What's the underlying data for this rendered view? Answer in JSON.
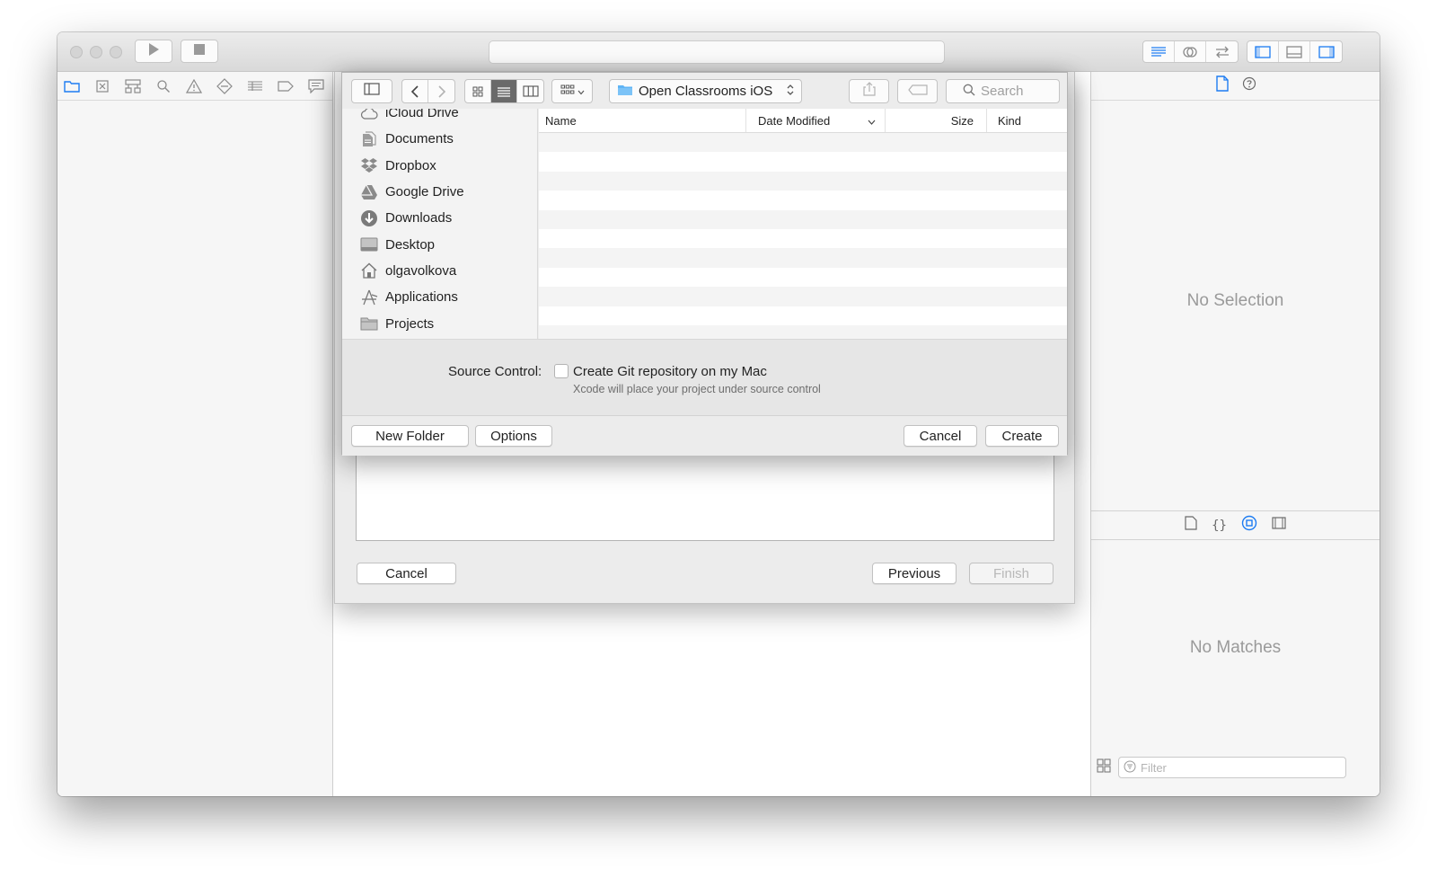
{
  "toolbar": {
    "activity_text": "",
    "run_icon": "play-icon",
    "stop_icon": "stop-icon"
  },
  "navigator": {
    "tabs": [
      "project-navigator-icon",
      "source-control-icon",
      "symbol-navigator-icon",
      "find-icon",
      "issue-icon",
      "test-icon",
      "debug-icon",
      "breakpoint-icon",
      "report-icon"
    ]
  },
  "inspector": {
    "no_selection": "No Selection",
    "no_matches": "No Matches",
    "filter_placeholder": "Filter"
  },
  "wizard": {
    "cancel_label": "Cancel",
    "previous_label": "Previous",
    "finish_label": "Finish"
  },
  "save_panel": {
    "location": "Open Classrooms iOS",
    "search_placeholder": "Search",
    "sidebar_items": [
      {
        "label": "iCloud Drive",
        "icon": "cloud-icon"
      },
      {
        "label": "Documents",
        "icon": "documents-icon"
      },
      {
        "label": "Dropbox",
        "icon": "dropbox-icon"
      },
      {
        "label": "Google Drive",
        "icon": "google-drive-icon"
      },
      {
        "label": "Downloads",
        "icon": "downloads-icon"
      },
      {
        "label": "Desktop",
        "icon": "desktop-icon"
      },
      {
        "label": "olgavolkova",
        "icon": "home-icon"
      },
      {
        "label": "Applications",
        "icon": "applications-icon"
      },
      {
        "label": "Projects",
        "icon": "folder-icon"
      }
    ],
    "columns": {
      "name": "Name",
      "date_modified": "Date Modified",
      "size": "Size",
      "kind": "Kind"
    },
    "source_control_label": "Source Control:",
    "git_checkbox_label": "Create Git repository on my Mac",
    "git_checked": false,
    "git_hint": "Xcode will place your project under source control",
    "new_folder_label": "New Folder",
    "options_label": "Options",
    "cancel_label": "Cancel",
    "create_label": "Create"
  },
  "colors": {
    "accent": "#1d7cf2",
    "folder_blue": "#5fb4f5",
    "disabled_text": "#b8b8b8"
  }
}
